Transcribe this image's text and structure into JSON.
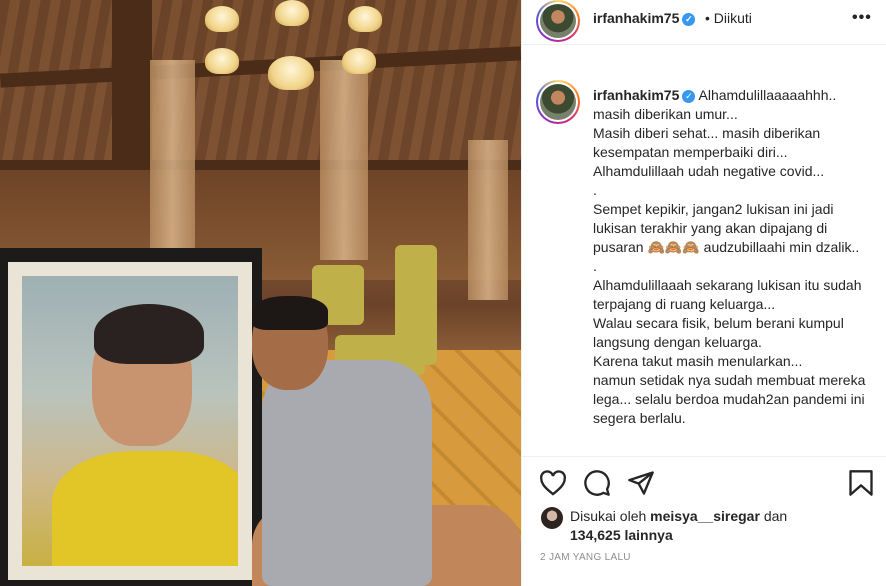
{
  "post": {
    "username": "irfanhakim75",
    "follow_status": "• Diikuti",
    "verified_icon": "verified-badge-icon",
    "more_icon": "more-options-icon"
  },
  "caption": {
    "username": "irfanhakim75",
    "lines": [
      "Alhamdulillaaaaahhh.. masih diberikan umur...",
      "Masih diberi sehat... masih diberikan kesempatan memperbaiki diri...",
      "Alhamdulillaah udah negative covid...",
      ".",
      "Sempet kepikir, jangan2 lukisan ini jadi lukisan terakhir yang akan dipajang di pusaran 🙈🙈🙈 audzubillaahi min dzalik..",
      ".",
      "Alhamdulillaaah sekarang lukisan itu sudah terpajang di ruang keluarga...",
      "Walau secara fisik, belum berani kumpul langsung dengan keluarga.",
      "Karena takut masih menularkan...",
      "namun setidak nya sudah membuat mereka lega... selalu berdoa mudah2an pandemi ini segera berlalu."
    ]
  },
  "actions": {
    "like_icon": "heart-icon",
    "comment_icon": "comment-icon",
    "share_icon": "send-icon",
    "save_icon": "bookmark-icon"
  },
  "likes": {
    "prefix": "Disukai oleh",
    "user": "meisya__siregar",
    "connector": "dan",
    "count": "134,625 lainnya"
  },
  "timestamp": "2 JAM YANG LALU",
  "colors": {
    "text": "#262626",
    "muted": "#8e8e8e",
    "verified": "#3897f0",
    "divider": "#efefef"
  }
}
